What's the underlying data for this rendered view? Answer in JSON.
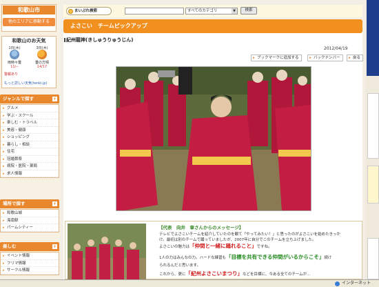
{
  "left": {
    "city_title": "和歌山市",
    "city_move": "他のエリアに移動する",
    "weather": {
      "title": "和歌山のお天気",
      "days": [
        {
          "day": "1日(木)",
          "desc": "雨時々曇",
          "temp": "11/--",
          "icon": "rain-cloud-icon"
        },
        {
          "day": "3日(木)",
          "desc": "曇の方晴",
          "temp": "14/17",
          "icon": "cloud-sun-icon"
        }
      ],
      "alert": "警報あり",
      "more": "もっと詳しい天気(tenki.jp)"
    },
    "genre": {
      "title": "ジャンルで探す",
      "items": [
        "グルメ",
        "学ぶ・スクール",
        "楽しむ・トラベル",
        "美容・健康",
        "ショッピング",
        "暮らし・相談",
        "住宅",
        "冠婚葬祭",
        "病院・医院・薬局",
        "求人情報"
      ]
    },
    "place": {
      "title": "場所で探す",
      "items": [
        "和歌山城",
        "海南駅",
        "パームシティー"
      ]
    },
    "enjoy": {
      "title": "楽しむ",
      "items": [
        "イベント情報",
        "フリマ情報",
        "サークル情報"
      ]
    }
  },
  "search": {
    "label": "まいぷれ検索",
    "input_value": "",
    "category": "すべてのカテゴリ",
    "button": "検索"
  },
  "main": {
    "title": "よさこい　チームピックアップ",
    "subtitle": "紀州龍神(きしゅうりゅうじん)",
    "date": "2012/04/19",
    "buttons": {
      "bookmark": "ブックマークに追加する",
      "back_number": "バックナンバー",
      "back": "戻る"
    },
    "message": {
      "head": "【代表　向井　章さんからのメッセージ】",
      "p1": "テレビでよさこいチームを紹介していたのを観て「やってみたい！」と思ったのがよさこいを始めたきっか",
      "p2": "け。最初は別のチームで踊っていましたが、2007年に自分でこのチームを立ち上げました。",
      "p3": "よさこいの魅力は",
      "p3_hl": "「仲間と一緒に踊れること」",
      "p3_tail": "ですね。",
      "p4": "1人の力はみんなの力。ハードな練習も",
      "p4_hl": "「目標を共有できる仲間がいるからこそ」",
      "p4_tail": "続け",
      "p5": "られるんだと思います。",
      "p6": "これから、更に",
      "p6_hl": "「紀州よさこいまつり」",
      "p6_tail": "などを目標に、今ある全てのチームが..."
    }
  },
  "status": {
    "zone": "インターネット"
  },
  "colors": {
    "accent": "#f18f1f",
    "section": "#e9872d",
    "highlight_red": "#d21b1b",
    "highlight_green": "#238a1e"
  }
}
